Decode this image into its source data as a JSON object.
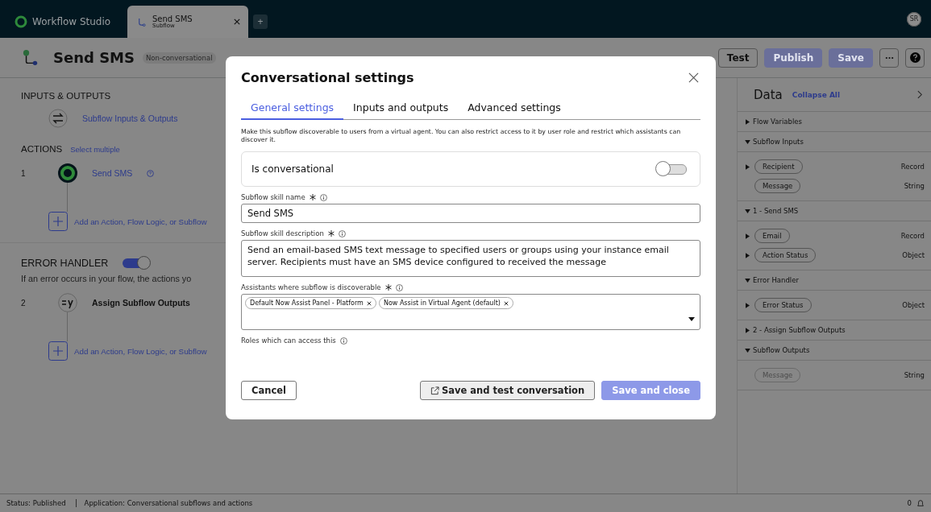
{
  "app_bar": {
    "app_name": "Workflow Studio",
    "tabs": [
      {
        "title": "Send SMS",
        "subtitle": "Subflow",
        "selected": true
      }
    ],
    "new_tab": "+",
    "avatar": "SR"
  },
  "header": {
    "title": "Send SMS",
    "badge": "Non-conversational",
    "buttons": [
      {
        "label": "Test",
        "kind": "secondary"
      },
      {
        "label": "Publish",
        "kind": "primary",
        "disabled": true
      },
      {
        "label": "Save",
        "kind": "primary",
        "disabled": true
      },
      {
        "kind": "more"
      },
      {
        "kind": "help"
      }
    ]
  },
  "canvas": {
    "inputs_outputs": {
      "heading": "INPUTS & OUTPUTS",
      "item": "Subflow Inputs & Outputs"
    },
    "actions": {
      "heading": "ACTIONS",
      "link": "Select multiple",
      "steps": [
        {
          "number": "1",
          "label": "Send SMS",
          "kind": "action"
        }
      ],
      "add_label": "Add an Action, Flow Logic, or Subflow"
    },
    "error_handler": {
      "heading": "ERROR HANDLER",
      "on": true,
      "description": "If an error occurs in your flow, the actions yo",
      "steps": [
        {
          "number": "2",
          "label": "Assign Subflow Outputs",
          "kind": "assign"
        }
      ],
      "add_label": "Add an Action, Flow Logic, or Subflow"
    }
  },
  "data_panel": {
    "title": "Data",
    "link": "Collapse All",
    "sections": [
      {
        "label": "Flow Variables",
        "expanded": false
      },
      {
        "label": "Subflow Inputs",
        "expanded": true,
        "items": [
          {
            "name": "Recipient",
            "type": "Record",
            "expandable": true,
            "disabled": false
          },
          {
            "name": "Message",
            "type": "String",
            "expandable": false,
            "disabled": false
          }
        ]
      },
      {
        "label": "1 - Send SMS",
        "expanded": true,
        "items": [
          {
            "name": "Email",
            "type": "Record",
            "expandable": true,
            "disabled": false
          },
          {
            "name": "Action Status",
            "type": "Object",
            "expandable": true,
            "disabled": false
          }
        ]
      },
      {
        "label": "Error Handler",
        "expanded": true,
        "items": [
          {
            "name": "Error Status",
            "type": "Object",
            "expandable": true,
            "disabled": false
          }
        ]
      },
      {
        "label": "2 - Assign Subflow Outputs",
        "expanded": false
      },
      {
        "label": "Subflow Outputs",
        "expanded": true,
        "items": [
          {
            "name": "Message",
            "type": "String",
            "expandable": false,
            "disabled": true
          }
        ]
      }
    ]
  },
  "modal": {
    "title": "Conversational settings",
    "tabs": [
      {
        "label": "General settings",
        "selected": true
      },
      {
        "label": "Inputs and outputs",
        "selected": false
      },
      {
        "label": "Advanced settings",
        "selected": false
      }
    ],
    "intro": "Make this subflow discoverable to users from a virtual agent. You can also restrict access to it by user role and restrict which assistants can discover it.",
    "toggle": {
      "label": "Is conversational",
      "on": false
    },
    "fields": [
      {
        "kind": "input",
        "label": "Subflow skill name",
        "required": true,
        "value": "Send SMS"
      },
      {
        "kind": "textarea",
        "label": "Subflow skill description",
        "required": true,
        "value": "Send an email-based SMS text message to specified users or groups using your instance email server. Recipients must have an SMS device configured to received the message"
      },
      {
        "kind": "tags",
        "label": "Assistants where subflow is discoverable",
        "required": true,
        "tags": [
          "Default Now Assist Panel - Platform",
          "Now Assist in Virtual Agent (default)"
        ]
      },
      {
        "kind": "heading",
        "label": "Roles which can access this"
      }
    ],
    "buttons": [
      {
        "label": "Cancel",
        "kind": "outline",
        "disabled": false
      },
      {
        "label": "Save and test conversation",
        "kind": "secondary",
        "disabled": false
      },
      {
        "label": "Save and close",
        "kind": "primary",
        "disabled": true
      }
    ]
  },
  "status_bar": {
    "status": "Status: Published",
    "application": "Application: Conversational subflows and actions",
    "notifications": "0"
  }
}
